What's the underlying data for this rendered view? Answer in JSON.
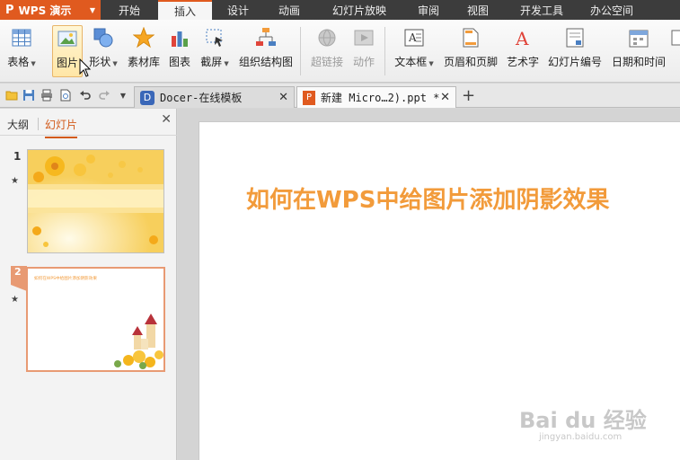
{
  "app": {
    "name": "WPS 演示",
    "logo": "P"
  },
  "menu": {
    "tabs": [
      {
        "label": "开始"
      },
      {
        "label": "插入"
      },
      {
        "label": "设计"
      },
      {
        "label": "动画"
      },
      {
        "label": "幻灯片放映"
      },
      {
        "label": "审阅"
      },
      {
        "label": "视图"
      },
      {
        "label": "开发工具"
      },
      {
        "label": "办公空间"
      }
    ],
    "active": "插入"
  },
  "ribbon": {
    "table": "表格",
    "picture": "图片",
    "shape": "形状",
    "material": "素材库",
    "chart": "图表",
    "screenshot": "截屏",
    "org_chart": "组织结构图",
    "hyperlink": "超链接",
    "action": "动作",
    "textbox": "文本框",
    "header_footer": "页眉和页脚",
    "wordart": "艺术字",
    "slide_number": "幻灯片编号",
    "datetime": "日期和时间"
  },
  "doc_tabs": [
    {
      "label": "Docer-在线模板"
    },
    {
      "label": "新建 Micro…2).ppt *"
    }
  ],
  "panel": {
    "tab_outline": "大纲",
    "tab_slides": "幻灯片",
    "slides": [
      {
        "num": "1"
      },
      {
        "num": "2",
        "text": "如何在WPS中给图片添加阴影效果"
      }
    ]
  },
  "slide": {
    "title": "如何在WPS中给图片添加阴影效果"
  },
  "watermark": {
    "brand": "Bai du 经验",
    "url": "jingyan.baidu.com"
  },
  "colors": {
    "accent": "#e05a1f",
    "title": "#f29b3b"
  }
}
